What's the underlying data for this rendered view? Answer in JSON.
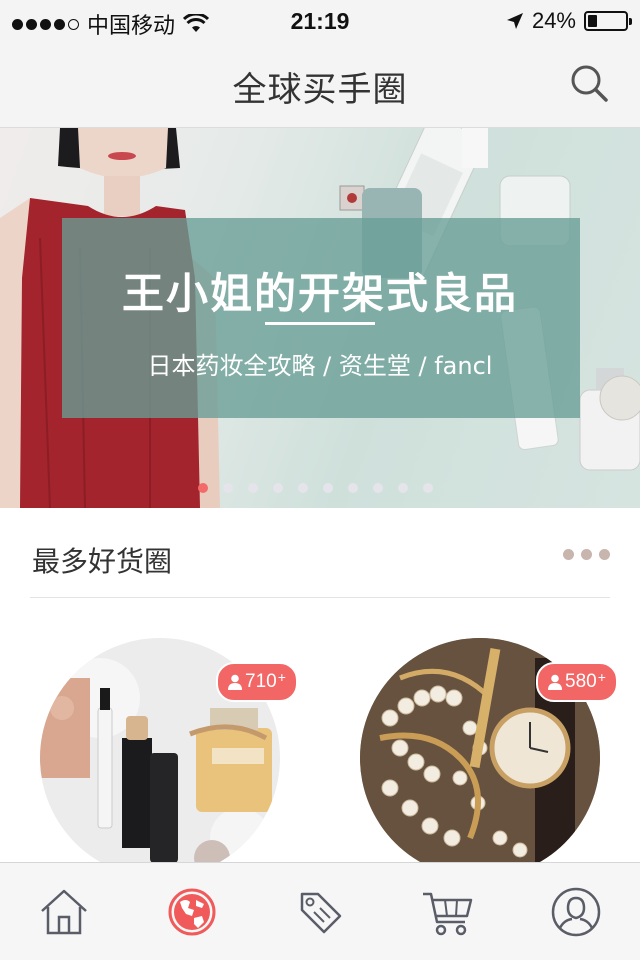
{
  "status_bar": {
    "carrier": "中国移动",
    "time": "21:19",
    "battery_percent": "24%",
    "battery_level": 0.24,
    "signal_strength": 4,
    "signal_max": 5
  },
  "navbar": {
    "title": "全球买手圈",
    "search_icon": "search-icon"
  },
  "banner": {
    "title": "王小姐的开架式良品",
    "subtitle": "日本药妆全攻略 / 资生堂 / fancl",
    "page_count": 10,
    "active_page": 0
  },
  "section": {
    "title": "最多好货圈",
    "more_icon": "more-dots-icon"
  },
  "cards": [
    {
      "count": "710",
      "plus": "+",
      "theme": "cosmetics"
    },
    {
      "count": "580",
      "plus": "+",
      "theme": "jewelry-watch"
    }
  ],
  "tabbar": {
    "items": [
      {
        "icon": "home-icon",
        "active": false
      },
      {
        "icon": "globe-icon",
        "active": true
      },
      {
        "icon": "tag-icon",
        "active": false
      },
      {
        "icon": "cart-icon",
        "active": false
      },
      {
        "icon": "user-icon",
        "active": false
      }
    ]
  },
  "colors": {
    "accent": "#f26666",
    "overlay": "#689e96",
    "icon": "#5a5d68"
  }
}
